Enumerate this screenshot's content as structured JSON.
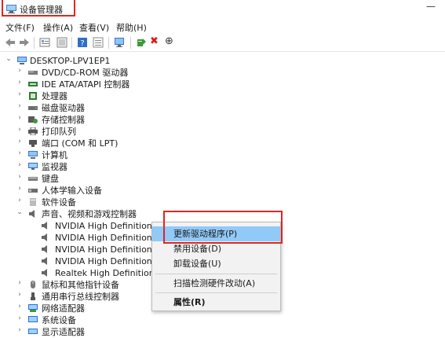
{
  "window": {
    "title": "设备管理器",
    "minimize_glyph": "—"
  },
  "menu": [
    "文件(F)",
    "操作(A)",
    "查看(V)",
    "帮助(H)"
  ],
  "toolbar": {
    "icons": [
      "back-icon",
      "forward-icon",
      "properties-icon",
      "show-hidden-icon",
      "help-icon",
      "view-icon",
      "monitor-icon",
      "update-driver-icon",
      "uninstall-icon",
      "scan-icon"
    ],
    "uninstall_glyph": "✖",
    "scan_glyph": "⊕"
  },
  "tree": {
    "root": "DESKTOP-LPV1EP1",
    "categories": [
      {
        "label": "DVD/CD-ROM 驱动器",
        "icon": "dvd-drive-icon"
      },
      {
        "label": "IDE ATA/ATAPI 控制器",
        "icon": "ide-controller-icon"
      },
      {
        "label": "处理器",
        "icon": "processor-icon"
      },
      {
        "label": "磁盘驱动器",
        "icon": "disk-drive-icon"
      },
      {
        "label": "存储控制器",
        "icon": "storage-controller-icon"
      },
      {
        "label": "打印队列",
        "icon": "printer-icon"
      },
      {
        "label": "端口 (COM 和 LPT)",
        "icon": "port-icon"
      },
      {
        "label": "计算机",
        "icon": "computer-icon"
      },
      {
        "label": "监视器",
        "icon": "monitor-icon"
      },
      {
        "label": "键盘",
        "icon": "keyboard-icon"
      },
      {
        "label": "人体学输入设备",
        "icon": "hid-icon"
      },
      {
        "label": "软件设备",
        "icon": "software-device-icon"
      },
      {
        "label": "声音、视频和游戏控制器",
        "icon": "audio-icon",
        "expanded": true
      },
      {
        "label": "鼠标和其他指针设备",
        "icon": "mouse-icon"
      },
      {
        "label": "通用串行总线控制器",
        "icon": "usb-icon"
      },
      {
        "label": "网络适配器",
        "icon": "network-adapter-icon"
      },
      {
        "label": "系统设备",
        "icon": "system-device-icon"
      },
      {
        "label": "显示适配器",
        "icon": "display-adapter-icon"
      }
    ],
    "audio_children": [
      "NVIDIA High Definition Au",
      "NVIDIA High Definition Au",
      "NVIDIA High Definition Au",
      "NVIDIA High Definition Au",
      "Realtek High Definition Au"
    ]
  },
  "context_menu": {
    "items": [
      "更新驱动程序(P)",
      "禁用设备(D)",
      "卸载设备(U)",
      "扫描检测硬件改动(A)",
      "属性(R)"
    ],
    "active_index": 0
  },
  "colors": {
    "highlight": "#e0261f",
    "menu_hover": "#91c9f7"
  }
}
